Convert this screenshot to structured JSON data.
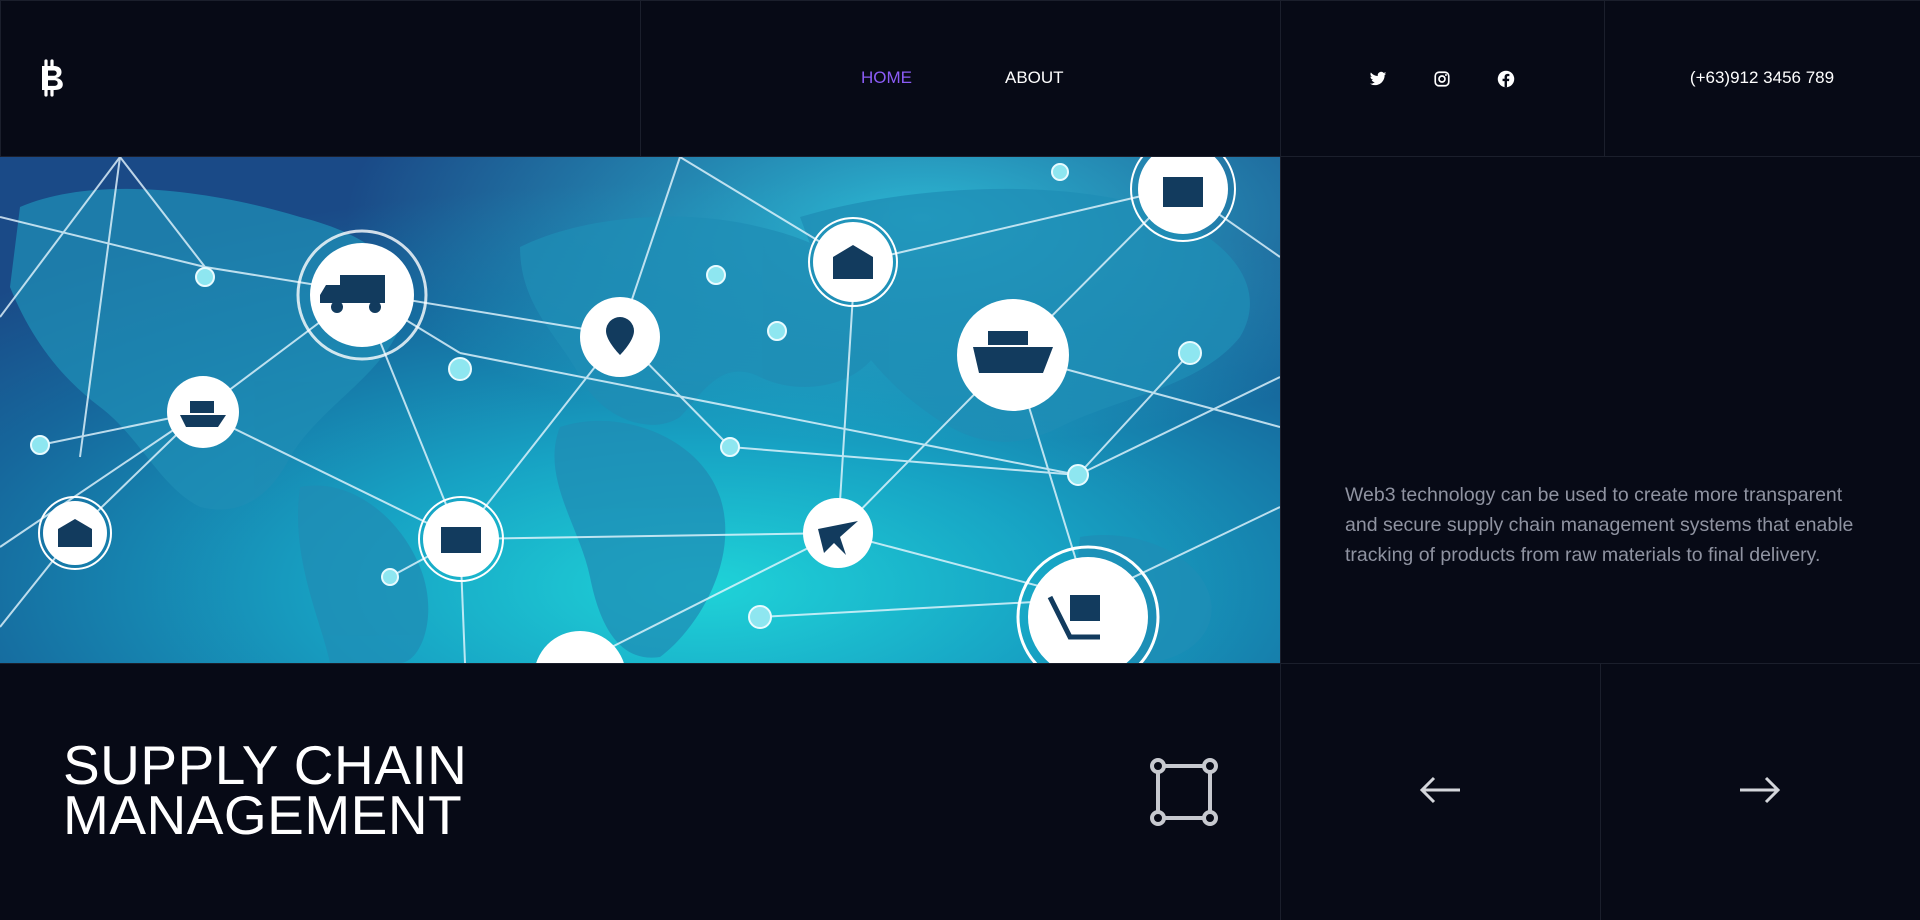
{
  "header": {
    "logo_icon": "bitcoin-icon",
    "nav": [
      {
        "label": "HOME",
        "active": true,
        "color": "#8b5cf6"
      },
      {
        "label": "ABOUT",
        "active": false,
        "color": "#ffffff"
      }
    ],
    "social": [
      "twitter-icon",
      "instagram-icon",
      "facebook-icon"
    ],
    "phone": "(+63)912 3456 789"
  },
  "hero": {
    "image": "supply-chain-network-map",
    "description": "Web3 technology can be used to create more transparent and secure supply chain management systems that enable tracking of products from raw materials to final delivery."
  },
  "slide": {
    "title_line1": "SUPPLY CHAIN",
    "title_line2": "MANAGEMENT",
    "icon": "crop-square-icon",
    "prev_icon": "arrow-left-icon",
    "next_icon": "arrow-right-icon"
  },
  "colors": {
    "background": "#070a16",
    "accent": "#8b5cf6",
    "border": "#1b1f2c",
    "text_muted": "#8f93a1"
  }
}
